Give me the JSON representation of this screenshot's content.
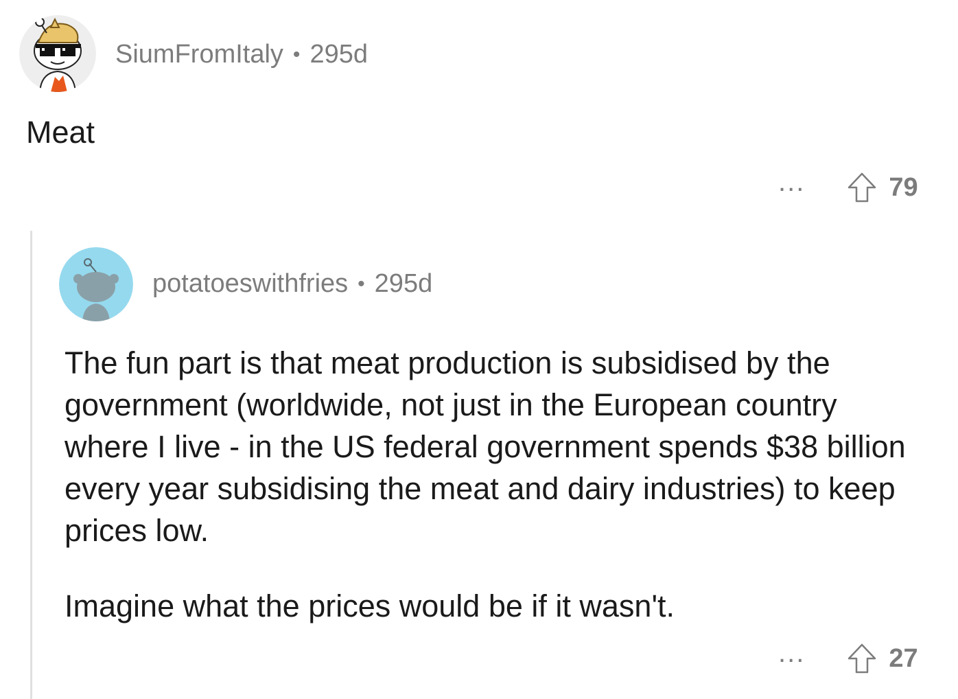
{
  "parent_comment": {
    "username": "SiumFromItaly",
    "separator": "•",
    "age": "295d",
    "body": "Meat",
    "more_label": "...",
    "upvote_count": "79",
    "avatar_icon": "snoo-sunglasses-avatar-icon"
  },
  "reply_comment": {
    "username": "potatoeswithfries",
    "separator": "•",
    "age": "295d",
    "paragraph_1": "The fun part is that meat production is subsidised by the government (worldwide, not just in the European country where I live - in the US federal government spends $38 billion every year subsidising the meat and dairy industries) to keep prices low.",
    "paragraph_2": "Imagine what the prices would be if it wasn't.",
    "more_label": "...",
    "upvote_count": "27",
    "avatar_icon": "snoo-default-avatar-icon"
  },
  "colors": {
    "meta_text": "#7c7c7c",
    "body_text": "#1a1a1b",
    "thread_line": "#e0e0e0",
    "default_avatar_bg": "#95d9ee"
  }
}
